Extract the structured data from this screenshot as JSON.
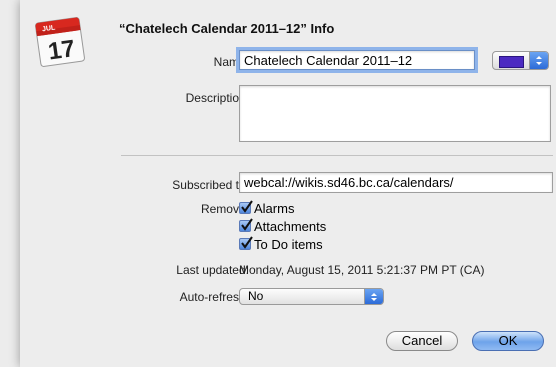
{
  "dialog": {
    "title": "“Chatelech Calendar 2011–12” Info",
    "icon": {
      "name": "calendar-icon",
      "month": "JUL",
      "day": "17"
    }
  },
  "form": {
    "name_label": "Name:",
    "name_value": "Chatelech Calendar 2011–12",
    "color": "#4b2ac1",
    "description_label": "Description:",
    "description_value": "",
    "subscribed_label": "Subscribed to:",
    "subscribed_value": "webcal://wikis.sd46.bc.ca/calendars/",
    "remove_label": "Remove:",
    "remove_options": [
      {
        "label": "Alarms",
        "checked": true
      },
      {
        "label": "Attachments",
        "checked": true
      },
      {
        "label": "To Do items",
        "checked": true
      }
    ],
    "last_updated_label": "Last updated:",
    "last_updated_value": "Monday, August 15, 2011 5:21:37 PM PT (CA)",
    "auto_refresh_label": "Auto-refresh:",
    "auto_refresh_value": "No"
  },
  "buttons": {
    "cancel": "Cancel",
    "ok": "OK"
  }
}
